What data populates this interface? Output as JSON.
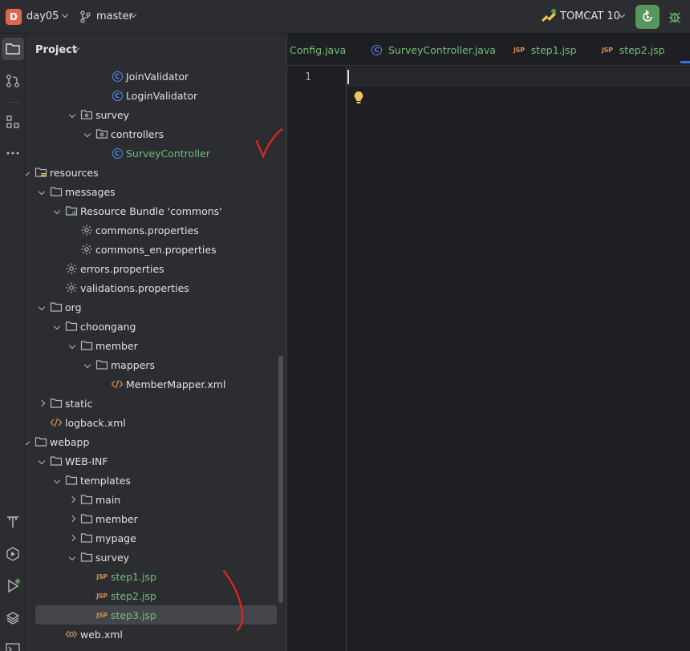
{
  "titlebar": {
    "project_initial": "D",
    "project_name": "day05",
    "branch": "master",
    "run_config": "TOMCAT 10"
  },
  "panel": {
    "title": "Project"
  },
  "tree": [
    {
      "label": "JoinValidator",
      "icon": "class-icon",
      "depth": 8,
      "arrow": "none",
      "green": false
    },
    {
      "label": "LoginValidator",
      "icon": "class-icon",
      "depth": 8,
      "arrow": "none",
      "green": false
    },
    {
      "label": "survey",
      "icon": "package-icon",
      "depth": 6,
      "arrow": "down",
      "green": false
    },
    {
      "label": "controllers",
      "icon": "package-icon",
      "depth": 7,
      "arrow": "down",
      "green": false
    },
    {
      "label": "SurveyController",
      "icon": "class-icon",
      "depth": 8,
      "arrow": "none",
      "green": true
    },
    {
      "label": "resources",
      "icon": "resources-folder-icon",
      "depth": 3,
      "arrow": "down",
      "green": false
    },
    {
      "label": "messages",
      "icon": "folder-icon",
      "depth": 4,
      "arrow": "down",
      "green": false
    },
    {
      "label": "Resource Bundle 'commons'",
      "icon": "resource-bundle-icon",
      "depth": 5,
      "arrow": "down",
      "green": false
    },
    {
      "label": "commons.properties",
      "icon": "properties-icon",
      "depth": 6,
      "arrow": "none",
      "green": false
    },
    {
      "label": "commons_en.properties",
      "icon": "properties-icon",
      "depth": 6,
      "arrow": "none",
      "green": false
    },
    {
      "label": "errors.properties",
      "icon": "properties-icon",
      "depth": 5,
      "arrow": "none",
      "green": false
    },
    {
      "label": "validations.properties",
      "icon": "properties-icon",
      "depth": 5,
      "arrow": "none",
      "green": false
    },
    {
      "label": "org",
      "icon": "folder-icon",
      "depth": 4,
      "arrow": "down",
      "green": false
    },
    {
      "label": "choongang",
      "icon": "folder-icon",
      "depth": 5,
      "arrow": "down",
      "green": false
    },
    {
      "label": "member",
      "icon": "folder-icon",
      "depth": 6,
      "arrow": "down",
      "green": false
    },
    {
      "label": "mappers",
      "icon": "folder-icon",
      "depth": 7,
      "arrow": "down",
      "green": false
    },
    {
      "label": "MemberMapper.xml",
      "icon": "xml-icon",
      "depth": 8,
      "arrow": "none",
      "green": false
    },
    {
      "label": "static",
      "icon": "folder-icon",
      "depth": 4,
      "arrow": "right",
      "green": false
    },
    {
      "label": "logback.xml",
      "icon": "xml-icon",
      "depth": 4,
      "arrow": "none",
      "green": false
    },
    {
      "label": "webapp",
      "icon": "folder-icon",
      "depth": 3,
      "arrow": "down",
      "green": false
    },
    {
      "label": "WEB-INF",
      "icon": "folder-icon",
      "depth": 4,
      "arrow": "down",
      "green": false
    },
    {
      "label": "templates",
      "icon": "folder-icon",
      "depth": 5,
      "arrow": "down",
      "green": false
    },
    {
      "label": "main",
      "icon": "folder-icon",
      "depth": 6,
      "arrow": "right",
      "green": false
    },
    {
      "label": "member",
      "icon": "folder-icon",
      "depth": 6,
      "arrow": "right",
      "green": false
    },
    {
      "label": "mypage",
      "icon": "folder-icon",
      "depth": 6,
      "arrow": "right",
      "green": false
    },
    {
      "label": "survey",
      "icon": "folder-icon",
      "depth": 6,
      "arrow": "down",
      "green": false
    },
    {
      "label": "step1.jsp",
      "icon": "jsp-icon",
      "depth": 7,
      "arrow": "none",
      "green": true
    },
    {
      "label": "step2.jsp",
      "icon": "jsp-icon",
      "depth": 7,
      "arrow": "none",
      "green": true
    },
    {
      "label": "step3.jsp",
      "icon": "jsp-icon",
      "depth": 7,
      "arrow": "none",
      "green": true,
      "selected": true
    },
    {
      "label": "web.xml",
      "icon": "web-xml-icon",
      "depth": 5,
      "arrow": "none",
      "green": false
    }
  ],
  "tabs": [
    {
      "label": "Config.java",
      "icon": "none",
      "green": true
    },
    {
      "label": "SurveyController.java",
      "icon": "class-icon",
      "green": true
    },
    {
      "label": "step1.jsp",
      "icon": "jsp-icon",
      "green": true
    },
    {
      "label": "step2.jsp",
      "icon": "jsp-icon",
      "green": true
    }
  ],
  "editor": {
    "line_number": "1"
  },
  "jsp_glyph": "JSP",
  "class_glyph": "C",
  "colors": {
    "accent": "#3574f0",
    "run": "#57965c",
    "vcs_added": "#73bd79",
    "annotation": "#e0261f"
  }
}
